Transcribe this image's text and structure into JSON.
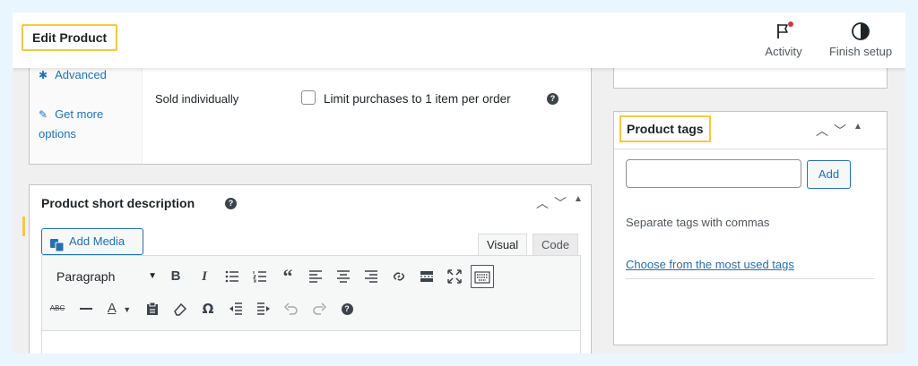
{
  "header": {
    "title": "Edit Product",
    "activity_label": "Activity",
    "finish_setup_label": "Finish setup"
  },
  "product_data": {
    "tabs": [
      {
        "label": "Advanced",
        "icon": "gear-icon"
      },
      {
        "label": "Get more options",
        "icon": "plugin-icon"
      }
    ],
    "sold_individually_label": "Sold individually",
    "limit_checkbox_label": "Limit purchases to 1 item per order",
    "limit_checkbox_checked": false
  },
  "short_description": {
    "title": "Product short description",
    "add_media_label": "Add Media",
    "tab_visual": "Visual",
    "tab_code": "Code",
    "format_select_value": "Paragraph"
  },
  "tags": {
    "title": "Product tags",
    "input_value": "",
    "add_label": "Add",
    "hint": "Separate tags with commas",
    "most_used_link": "Choose from the most used tags"
  },
  "colors": {
    "highlight": "#f6c744",
    "link": "#2271b1",
    "background": "#e9f6fd",
    "notification_dot": "#d63638"
  }
}
